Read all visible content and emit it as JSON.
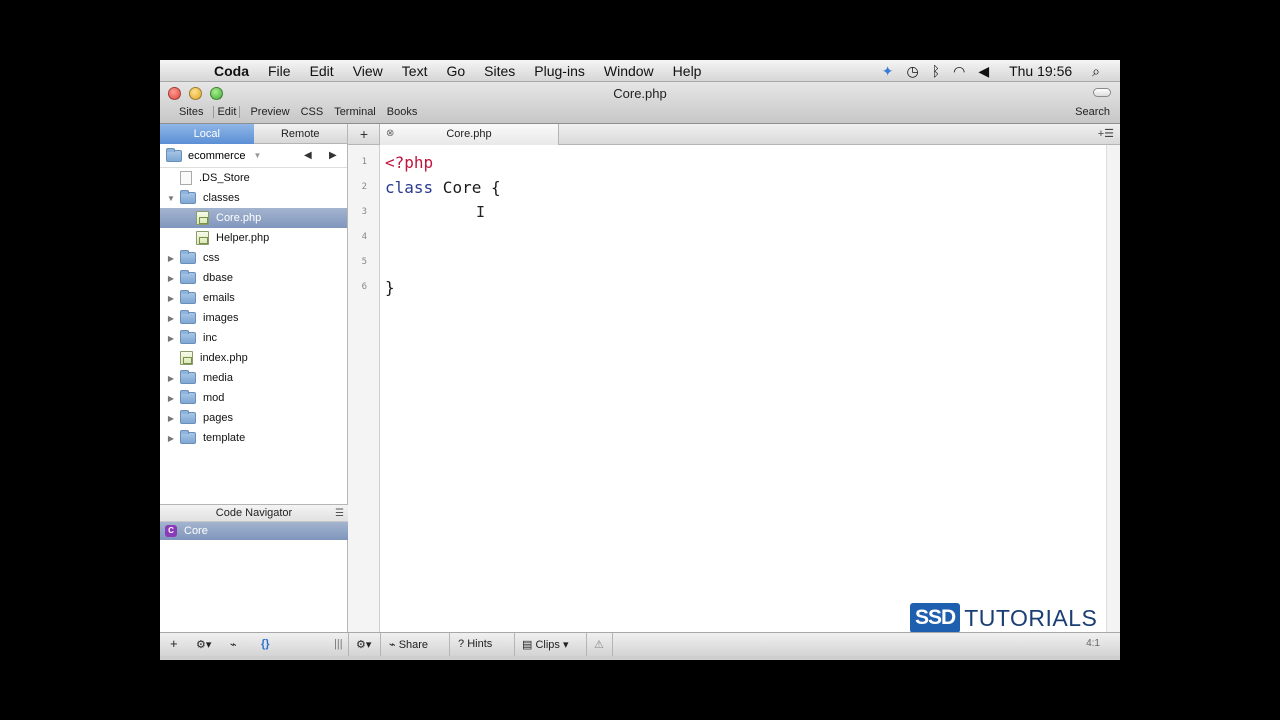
{
  "menubar": {
    "apple": "",
    "app": "Coda",
    "items": [
      "File",
      "Edit",
      "View",
      "Text",
      "Go",
      "Sites",
      "Plug-ins",
      "Window",
      "Help"
    ],
    "clock": "Thu 19:56"
  },
  "window": {
    "title": "Core.php",
    "modes": [
      "Sites",
      "Edit",
      "Preview",
      "CSS",
      "Terminal",
      "Books"
    ],
    "search_label": "Search"
  },
  "sidebar": {
    "tabs": {
      "local": "Local",
      "remote": "Remote"
    },
    "site": "ecommerce",
    "files": [
      {
        "name": ".DS_Store",
        "kind": "file",
        "depth": 1
      },
      {
        "name": "classes",
        "kind": "folder",
        "depth": 0,
        "expanded": true
      },
      {
        "name": "Core.php",
        "kind": "php",
        "depth": 2,
        "selected": true
      },
      {
        "name": "Helper.php",
        "kind": "php",
        "depth": 2
      },
      {
        "name": "css",
        "kind": "folder",
        "depth": 0
      },
      {
        "name": "dbase",
        "kind": "folder",
        "depth": 0
      },
      {
        "name": "emails",
        "kind": "folder",
        "depth": 0
      },
      {
        "name": "images",
        "kind": "folder",
        "depth": 0
      },
      {
        "name": "inc",
        "kind": "folder",
        "depth": 0
      },
      {
        "name": "index.php",
        "kind": "php",
        "depth": 1
      },
      {
        "name": "media",
        "kind": "folder",
        "depth": 0
      },
      {
        "name": "mod",
        "kind": "folder",
        "depth": 0
      },
      {
        "name": "pages",
        "kind": "folder",
        "depth": 0
      },
      {
        "name": "template",
        "kind": "folder",
        "depth": 0
      }
    ],
    "navigator": {
      "title": "Code Navigator",
      "badge": "C",
      "item": "Core"
    }
  },
  "editor": {
    "tab": "Core.php",
    "line_numbers": [
      "1",
      "2",
      "3",
      "4",
      "5",
      "6"
    ],
    "lines": {
      "l1": "<?php",
      "l2_kw": "class",
      "l2_rest": " Core {",
      "l6": "}"
    },
    "colors": {
      "php_tag": "#c0143c",
      "keyword": "#2a3b8f",
      "selection": "#8096bd"
    }
  },
  "bottombar": {
    "share": "Share",
    "hints": "Hints",
    "clips": "Clips",
    "position": "4:1"
  },
  "watermark": {
    "mark": "SSD",
    "text": "TUTORIALS"
  }
}
